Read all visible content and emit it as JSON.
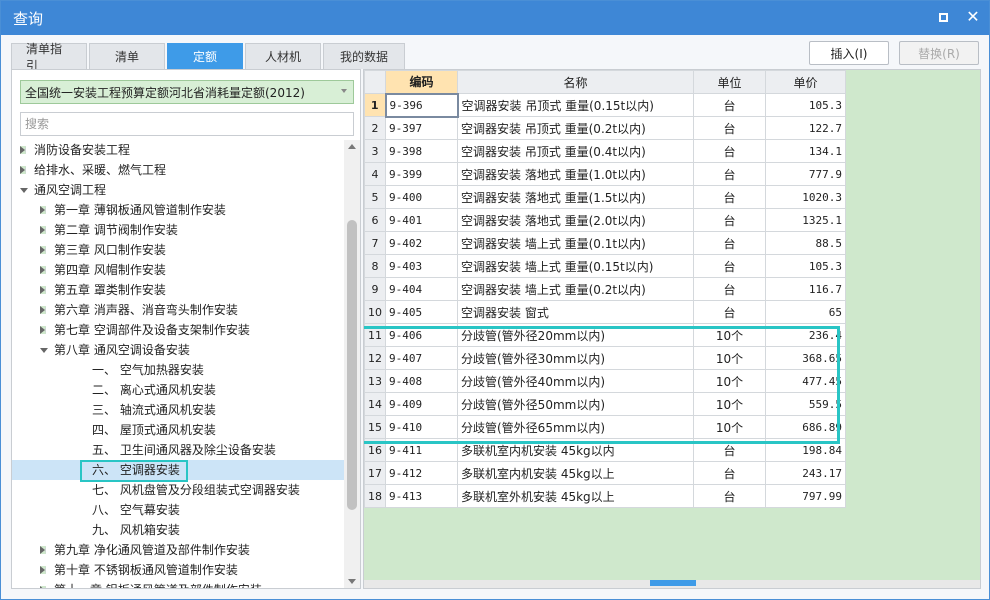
{
  "window": {
    "title": "查询"
  },
  "tabs": [
    {
      "label": "清单指引",
      "active": false
    },
    {
      "label": "清单",
      "active": false
    },
    {
      "label": "定额",
      "active": true
    },
    {
      "label": "人材机",
      "active": false
    },
    {
      "label": "我的数据",
      "active": false
    }
  ],
  "actions": {
    "insert_label": "插入(I)",
    "replace_label": "替换(R)"
  },
  "left": {
    "quota_select": "全国统一安装工程预算定额河北省消耗量定额(2012)",
    "search_placeholder": "搜索",
    "tree": [
      {
        "label": "消防设备安装工程",
        "level": 0,
        "state": "collapsed"
      },
      {
        "label": "给排水、采暖、燃气工程",
        "level": 0,
        "state": "collapsed"
      },
      {
        "label": "通风空调工程",
        "level": 0,
        "state": "expanded"
      },
      {
        "label": "第一章 薄钢板通风管道制作安装",
        "level": 1,
        "state": "collapsed"
      },
      {
        "label": "第二章 调节阀制作安装",
        "level": 1,
        "state": "collapsed"
      },
      {
        "label": "第三章 风口制作安装",
        "level": 1,
        "state": "collapsed"
      },
      {
        "label": "第四章 风帽制作安装",
        "level": 1,
        "state": "collapsed"
      },
      {
        "label": "第五章 罩类制作安装",
        "level": 1,
        "state": "collapsed"
      },
      {
        "label": "第六章 消声器、消音弯头制作安装",
        "level": 1,
        "state": "collapsed"
      },
      {
        "label": "第七章 空调部件及设备支架制作安装",
        "level": 1,
        "state": "collapsed"
      },
      {
        "label": "第八章 通风空调设备安装",
        "level": 1,
        "state": "expanded"
      },
      {
        "label": "一、 空气加热器安装",
        "level": 2,
        "state": "leaf"
      },
      {
        "label": "二、 离心式通风机安装",
        "level": 2,
        "state": "leaf"
      },
      {
        "label": "三、 轴流式通风机安装",
        "level": 2,
        "state": "leaf"
      },
      {
        "label": "四、 屋顶式通风机安装",
        "level": 2,
        "state": "leaf"
      },
      {
        "label": "五、 卫生间通风器及除尘设备安装",
        "level": 2,
        "state": "leaf"
      },
      {
        "label": "六、 空调器安装",
        "level": 2,
        "state": "leaf",
        "selected": true
      },
      {
        "label": "七、 风机盘管及分段组装式空调器安装",
        "level": 2,
        "state": "leaf"
      },
      {
        "label": "八、 空气幕安装",
        "level": 2,
        "state": "leaf"
      },
      {
        "label": "九、 风机箱安装",
        "level": 2,
        "state": "leaf"
      },
      {
        "label": "第九章 净化通风管道及部件制作安装",
        "level": 1,
        "state": "collapsed"
      },
      {
        "label": "第十章 不锈钢板通风管道制作安装",
        "level": 1,
        "state": "collapsed"
      },
      {
        "label": "第十一章 铝板通风管道及部件制作安装",
        "level": 1,
        "state": "collapsed"
      }
    ]
  },
  "grid": {
    "headers": {
      "code": "编码",
      "name": "名称",
      "unit": "单位",
      "price": "单价"
    },
    "rows": [
      {
        "n": "1",
        "code": "9-396",
        "name": "空调器安装 吊顶式 重量(0.15t以内)",
        "unit": "台",
        "price": "105.3"
      },
      {
        "n": "2",
        "code": "9-397",
        "name": "空调器安装 吊顶式 重量(0.2t以内)",
        "unit": "台",
        "price": "122.7"
      },
      {
        "n": "3",
        "code": "9-398",
        "name": "空调器安装 吊顶式 重量(0.4t以内)",
        "unit": "台",
        "price": "134.1"
      },
      {
        "n": "4",
        "code": "9-399",
        "name": "空调器安装 落地式 重量(1.0t以内)",
        "unit": "台",
        "price": "777.9"
      },
      {
        "n": "5",
        "code": "9-400",
        "name": "空调器安装 落地式 重量(1.5t以内)",
        "unit": "台",
        "price": "1020.3"
      },
      {
        "n": "6",
        "code": "9-401",
        "name": "空调器安装 落地式 重量(2.0t以内)",
        "unit": "台",
        "price": "1325.1"
      },
      {
        "n": "7",
        "code": "9-402",
        "name": "空调器安装 墙上式 重量(0.1t以内)",
        "unit": "台",
        "price": "88.5"
      },
      {
        "n": "8",
        "code": "9-403",
        "name": "空调器安装 墙上式 重量(0.15t以内)",
        "unit": "台",
        "price": "105.3"
      },
      {
        "n": "9",
        "code": "9-404",
        "name": "空调器安装 墙上式 重量(0.2t以内)",
        "unit": "台",
        "price": "116.7"
      },
      {
        "n": "10",
        "code": "9-405",
        "name": "空调器安装 窗式",
        "unit": "台",
        "price": "65"
      },
      {
        "n": "11",
        "code": "9-406",
        "name": "分歧管(管外径20mm以内)",
        "unit": "10个",
        "price": "236.4"
      },
      {
        "n": "12",
        "code": "9-407",
        "name": "分歧管(管外径30mm以内)",
        "unit": "10个",
        "price": "368.65"
      },
      {
        "n": "13",
        "code": "9-408",
        "name": "分歧管(管外径40mm以内)",
        "unit": "10个",
        "price": "477.45"
      },
      {
        "n": "14",
        "code": "9-409",
        "name": "分歧管(管外径50mm以内)",
        "unit": "10个",
        "price": "559.5"
      },
      {
        "n": "15",
        "code": "9-410",
        "name": "分歧管(管外径65mm以内)",
        "unit": "10个",
        "price": "686.89"
      },
      {
        "n": "16",
        "code": "9-411",
        "name": "多联机室内机安装 45kg以内",
        "unit": "台",
        "price": "198.84"
      },
      {
        "n": "17",
        "code": "9-412",
        "name": "多联机室内机安装 45kg以上",
        "unit": "台",
        "price": "243.17"
      },
      {
        "n": "18",
        "code": "9-413",
        "name": "多联机室外机安装 45kg以上",
        "unit": "台",
        "price": "797.99"
      }
    ]
  },
  "colors": {
    "title_bar": "#3e87d6",
    "active_tab": "#3e9be8",
    "highlight_frame": "#29c5c5",
    "grid_background": "#cfe8cc",
    "selected_node": "#cce4f7"
  }
}
